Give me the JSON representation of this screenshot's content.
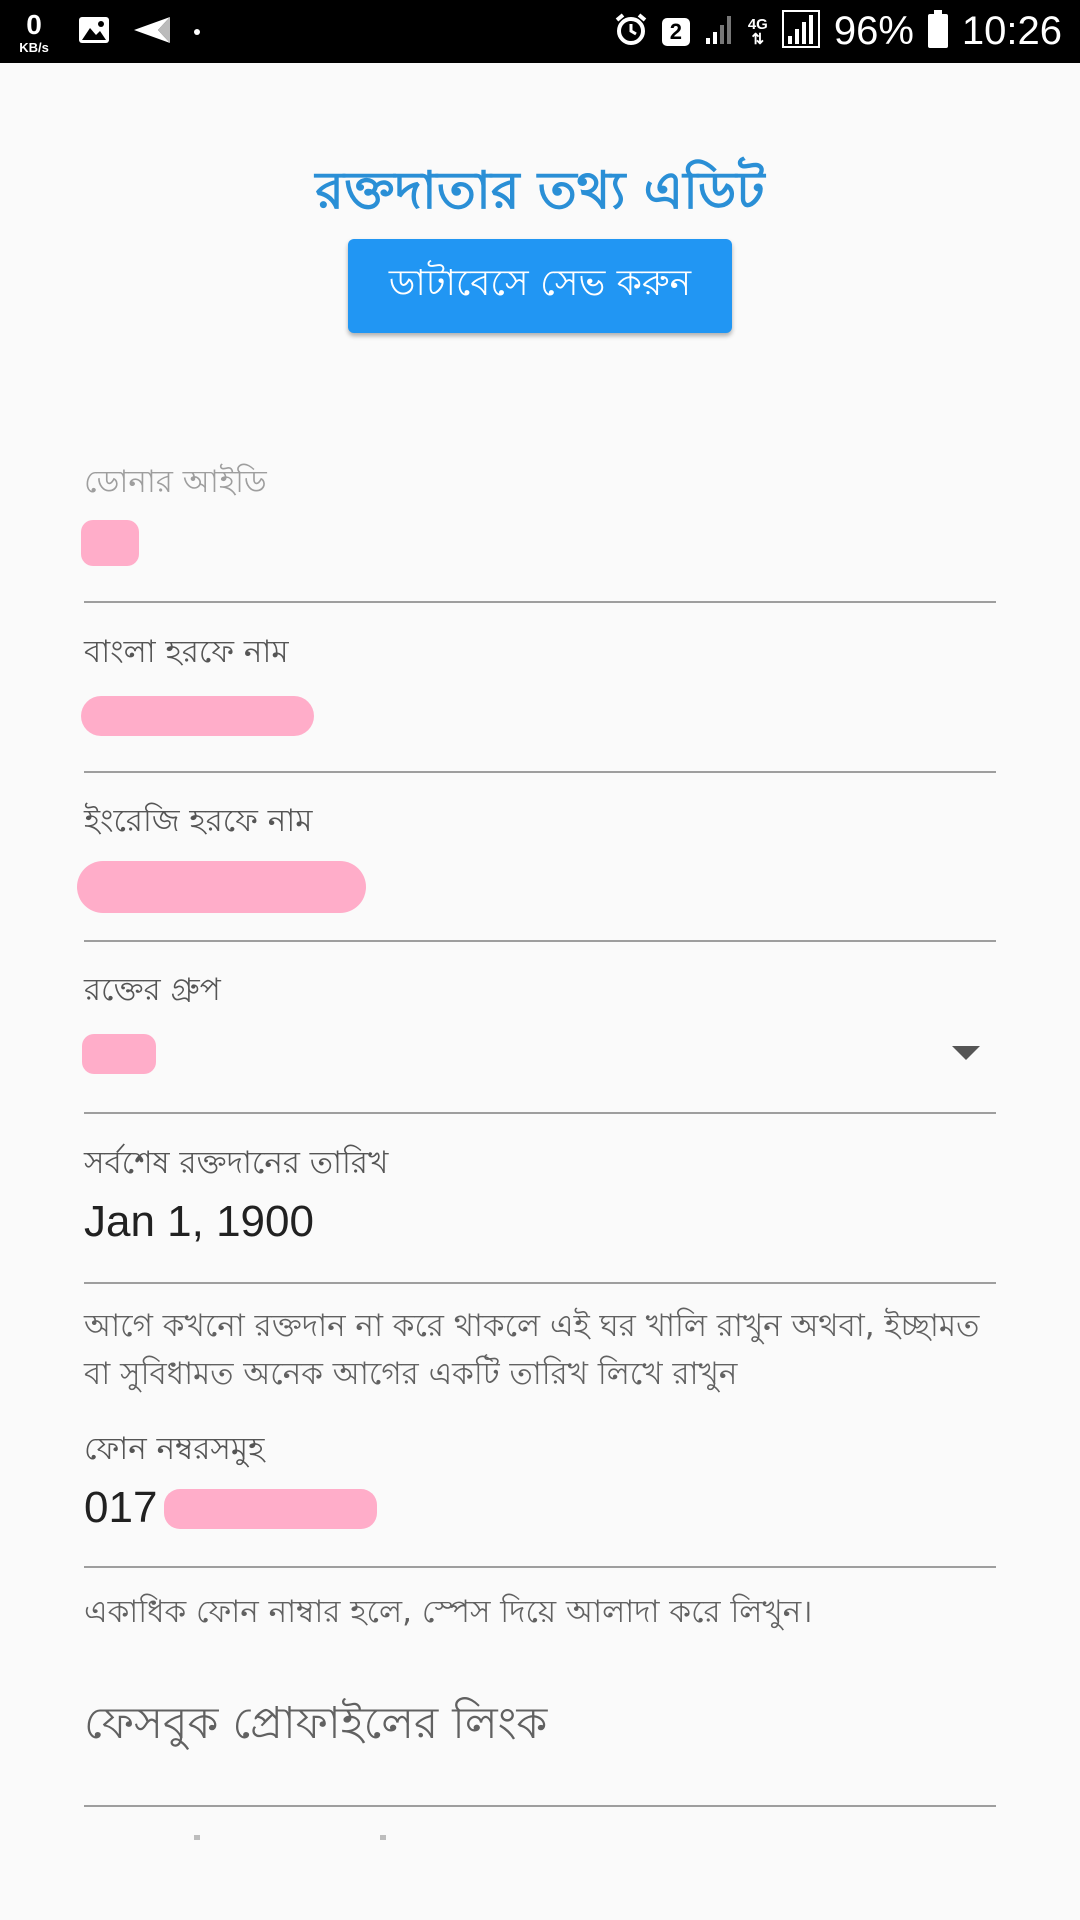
{
  "status_bar": {
    "speed_value": "0",
    "speed_unit": "KB/s",
    "network_label": "4G",
    "sim_badge": "2",
    "battery_percent": "96%",
    "time": "10:26"
  },
  "header": {
    "title": "রক্তদাতার তথ্য এডিট",
    "save_button": "ডাটাবেসে সেভ করুন"
  },
  "form": {
    "donor_id": {
      "label": "ডোনার আইডি",
      "value": ""
    },
    "name_bangla": {
      "label": "বাংলা হরফে নাম",
      "value": ""
    },
    "name_english": {
      "label": "ইংরেজি হরফে নাম",
      "value": ""
    },
    "blood_group": {
      "label": "রক্তের গ্রুপ",
      "value": ""
    },
    "last_donation": {
      "label": "সর্বশেষ রক্তদানের তারিখ",
      "value": "Jan 1, 1900"
    },
    "last_donation_helper": "আগে কখনো রক্তদান না করে থাকলে এই ঘর খালি রাখুন অথবা, ইচ্ছামত বা সুবিধামত অনেক আগের একটি তারিখ লিখে রাখুন",
    "phones": {
      "label": "ফোন নম্বরসমুহ",
      "value": "017"
    },
    "phones_helper": "একাধিক ফোন নাম্বার হলে, স্পেস দিয়ে আলাদা করে লিখুন।",
    "facebook": {
      "label": "ফেসবুক প্রোফাইলের লিংক"
    }
  },
  "colors": {
    "accent": "#2196f3",
    "title": "#2a8fd6",
    "redaction": "#ffadc9"
  }
}
